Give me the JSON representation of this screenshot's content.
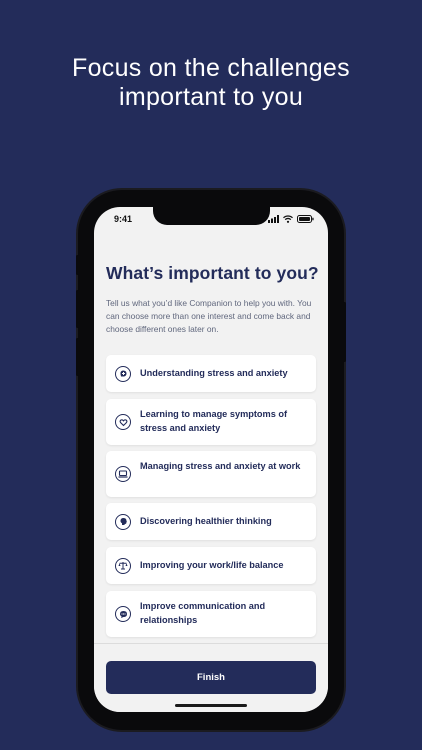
{
  "headline": {
    "line1": "Focus on the challenges",
    "line2": "important to you"
  },
  "status_bar": {
    "time": "9:41"
  },
  "page": {
    "title": "What’s important to you?",
    "description": "Tell us what you’d like Companion to help you with. You can choose more than one interest and come back and choose different ones later on."
  },
  "options": [
    {
      "label": "Understanding stress and anxiety",
      "icon": "brain-plus-icon"
    },
    {
      "label": "Learning to manage symptoms of stress and anxiety",
      "icon": "head-heart-icon"
    },
    {
      "label": "Managing stress and anxiety at work",
      "icon": "laptop-icon"
    },
    {
      "label": "Discovering healthier thinking",
      "icon": "head-profile-icon"
    },
    {
      "label": "Improving your work/life balance",
      "icon": "balance-scale-icon"
    },
    {
      "label": "Improve communication and relationships",
      "icon": "chat-bubble-icon"
    }
  ],
  "footer": {
    "finish_label": "Finish"
  },
  "colors": {
    "background": "#232c5a",
    "accent": "#232c5a",
    "screen": "#f2f2f2"
  }
}
